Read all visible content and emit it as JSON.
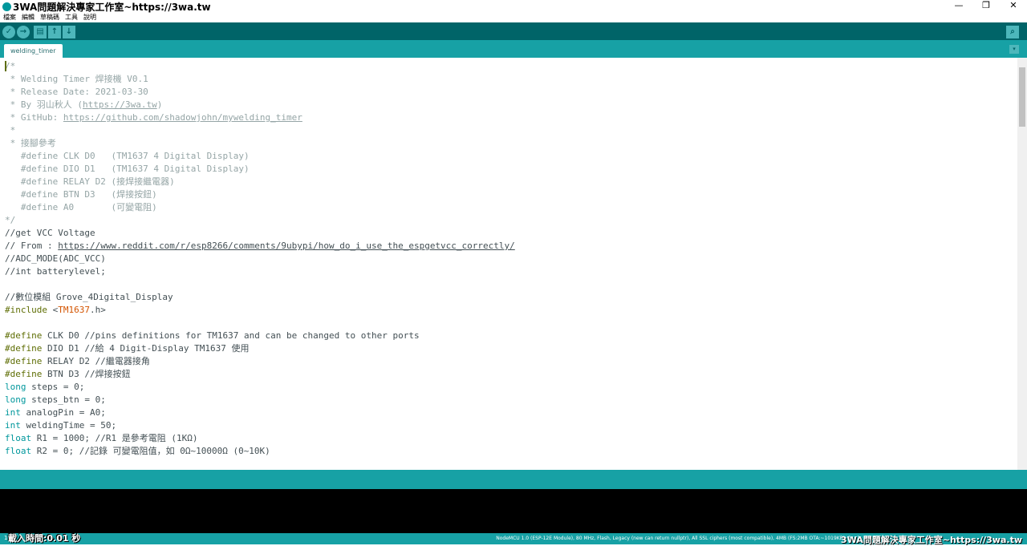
{
  "window": {
    "title": "3WA問題解決專家工作室~https://3wa.tw",
    "minimize": "—",
    "restore": "❐",
    "close": "✕"
  },
  "menu": [
    "檔案",
    "編輯",
    "草稿碼",
    "工具",
    "說明"
  ],
  "toolbar": {
    "verify": "✓",
    "upload": "→",
    "new": "▤",
    "open": "↑",
    "save": "↓",
    "serial_monitor": "⌕"
  },
  "tabs": [
    {
      "label": "welding_timer"
    }
  ],
  "tab_menu": "▾",
  "code": [
    [
      [
        "c",
        "/*"
      ]
    ],
    [
      [
        "c",
        " * Welding Timer 焊接機 V0.1"
      ]
    ],
    [
      [
        "c",
        " * Release Date: 2021-03-30"
      ]
    ],
    [
      [
        "c",
        " * By 羽山秋人 ("
      ],
      [
        "cu",
        "https://3wa.tw"
      ],
      [
        "c",
        ")"
      ]
    ],
    [
      [
        "c",
        " * GitHub: "
      ],
      [
        "cu",
        "https://github.com/shadowjohn/mywelding_timer"
      ]
    ],
    [
      [
        "c",
        " *"
      ]
    ],
    [
      [
        "c",
        " * 接腳參考"
      ]
    ],
    [
      [
        "c",
        "   #define CLK D0   (TM1637 4 Digital Display)"
      ]
    ],
    [
      [
        "c",
        "   #define DIO D1   (TM1637 4 Digital Display)"
      ]
    ],
    [
      [
        "c",
        "   #define RELAY D2 (接焊接繼電器)"
      ]
    ],
    [
      [
        "c",
        "   #define BTN D3   (焊接按鈕)"
      ]
    ],
    [
      [
        "c",
        "   #define A0       (可變電阻)"
      ]
    ],
    [
      [
        "c",
        "*/"
      ]
    ],
    [
      [
        "",
        "//get VCC Voltage"
      ]
    ],
    [
      [
        "",
        "// From : "
      ],
      [
        "u",
        "https://www.reddit.com/r/esp8266/comments/9ubypi/how_do_i_use_the_espgetvcc_correctly/"
      ]
    ],
    [
      [
        "",
        "//ADC_MODE(ADC_VCC)"
      ]
    ],
    [
      [
        "",
        "//int batterylevel;"
      ]
    ],
    [
      [
        "",
        ""
      ]
    ],
    [
      [
        "",
        "//數位模組 Grove_4Digital_Display"
      ]
    ],
    [
      [
        "p",
        "#include "
      ],
      [
        "",
        "<"
      ],
      [
        "o",
        "TM1637"
      ],
      [
        "",
        ".h>"
      ]
    ],
    [
      [
        "",
        ""
      ]
    ],
    [
      [
        "p",
        "#define"
      ],
      [
        "",
        " CLK D0 //pins definitions for TM1637 and can be changed to other ports"
      ]
    ],
    [
      [
        "p",
        "#define"
      ],
      [
        "",
        " DIO D1 //給 4 Digit-Display TM1637 使用"
      ]
    ],
    [
      [
        "p",
        "#define"
      ],
      [
        "",
        " RELAY D2 //繼電器接角"
      ]
    ],
    [
      [
        "p",
        "#define"
      ],
      [
        "",
        " BTN D3 //焊接按鈕"
      ]
    ],
    [
      [
        "k",
        "long"
      ],
      [
        "",
        " steps = 0;"
      ]
    ],
    [
      [
        "k",
        "long"
      ],
      [
        "",
        " steps_btn = 0;"
      ]
    ],
    [
      [
        "k",
        "int"
      ],
      [
        "",
        " analogPin = A0;"
      ]
    ],
    [
      [
        "k",
        "int"
      ],
      [
        "",
        " weldingTime = 50;"
      ]
    ],
    [
      [
        "k",
        "float"
      ],
      [
        "",
        " R1 = 1000; //R1 是參考電阻 (1KΩ)"
      ]
    ],
    [
      [
        "k",
        "float"
      ],
      [
        "",
        " R2 = 0; //記錄 可變電阻值，如 0Ω~10000Ω (0~10K)"
      ]
    ]
  ],
  "console": {
    "message": "載入時間:0.01 秒"
  },
  "status": {
    "line": "1",
    "board": "NodeMCU 1.0 (ESP-12E Module), 80 MHz, Flash, Legacy (new can return nullptr), All SSL ciphers (most compatible), 4MB (FS:2MB OTA:~1019KB), 2, v2",
    "brand": "3WA問題解決專家工作室~https://3wa.tw"
  },
  "colors": {
    "toolbar": "#006468",
    "tabbar": "#17a1a5",
    "keyword": "#00979c",
    "preprocessor": "#5e6d03",
    "comment": "#95a5a6",
    "library": "#d35400"
  }
}
